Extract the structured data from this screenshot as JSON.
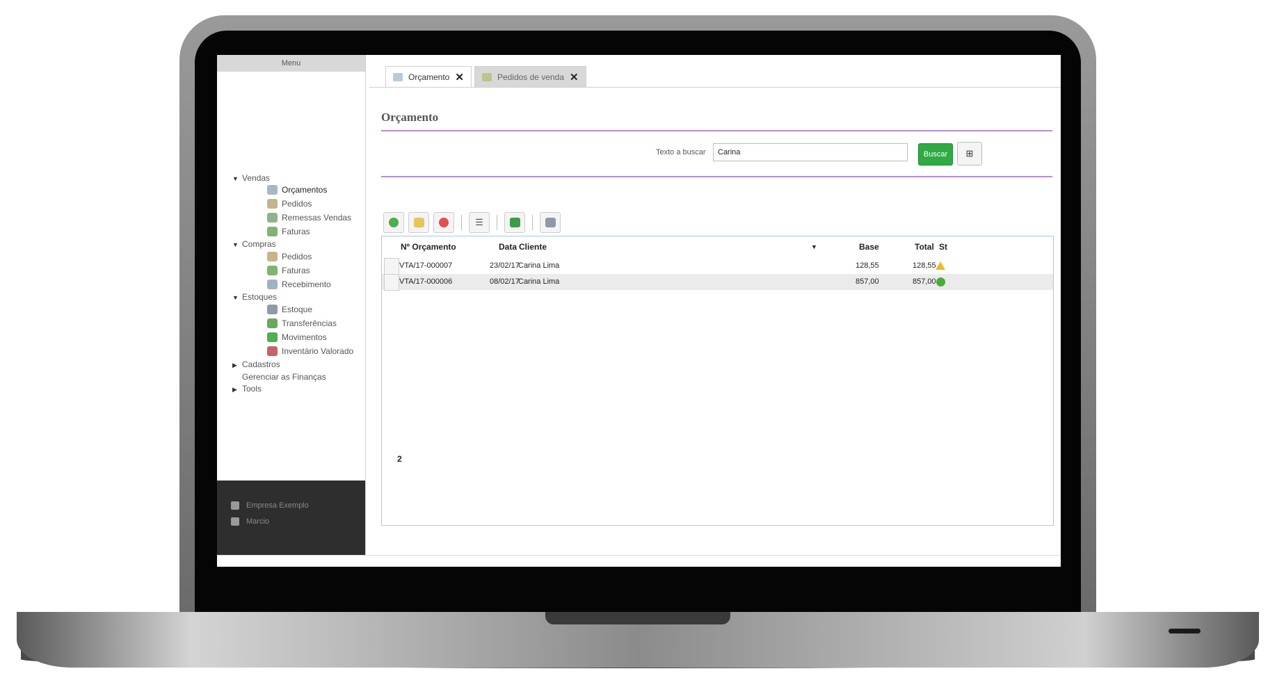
{
  "sidebar": {
    "header": "Menu",
    "groups": [
      {
        "label": "Vendas",
        "expanded": true
      },
      {
        "label": "Compras",
        "expanded": true
      },
      {
        "label": "Estoques",
        "expanded": true
      },
      {
        "label": "Cadastros",
        "expanded": false
      },
      {
        "label": "Gerenciar as Finanças",
        "expanded": false
      },
      {
        "label": "Tools",
        "expanded": false
      }
    ],
    "vendas_items": [
      "Orçamentos",
      "Pedidos",
      "Remessas Vendas",
      "Faturas"
    ],
    "compras_items": [
      "Pedidos",
      "Faturas",
      "Recebimento"
    ],
    "estoques_items": [
      "Estoque",
      "Transferências",
      "Movimentos",
      "Inventário Valorado"
    ],
    "footer": {
      "company": "Empresa Exemplo",
      "user": "Marcio"
    }
  },
  "tabs": [
    {
      "label": "Orçamento",
      "active": true
    },
    {
      "label": "Pedidos de venda",
      "active": false
    }
  ],
  "page_title": "Orçamento",
  "search": {
    "label": "Texto a buscar",
    "value": "Carina",
    "button": "Buscar"
  },
  "grid": {
    "headers": {
      "numero": "Nº Orçamento",
      "data": "Data",
      "cliente": "Cliente",
      "base": "Base",
      "total": "Total",
      "st": "St"
    },
    "rows": [
      {
        "numero": "VTA/17-000007",
        "data": "23/02/17",
        "cliente": "Carina Lima",
        "base": "128,55",
        "total": "128,55",
        "status": "warning"
      },
      {
        "numero": "VTA/17-000006",
        "data": "08/02/17",
        "cliente": "Carina Lima",
        "base": "857,00",
        "total": "857,00",
        "status": "ok"
      }
    ],
    "count": "2"
  },
  "colors": {
    "accent_purple": "#b98bd9",
    "buscar_green": "#2faa45",
    "grid_border": "#a9c8e8"
  }
}
